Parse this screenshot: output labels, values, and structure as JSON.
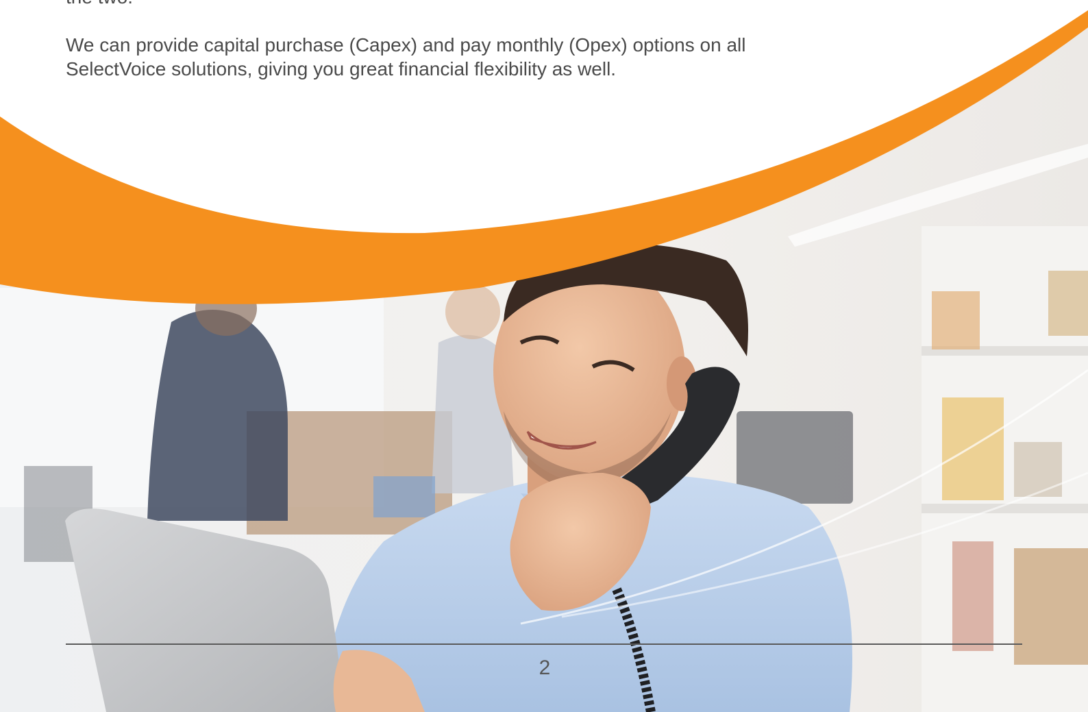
{
  "document": {
    "partial_line": "the two.",
    "paragraph": "We can provide capital purchase (Capex) and pay monthly (Opex) options on all SelectVoice solutions, giving you great financial flexibility as well.",
    "page_number": "2"
  },
  "colors": {
    "accent_orange": "#f5901e",
    "body_text": "#4a4a4a",
    "footer_rule": "#5a5a5a"
  }
}
